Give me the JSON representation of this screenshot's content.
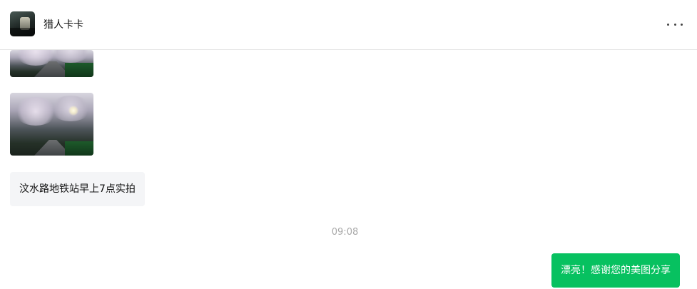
{
  "header": {
    "contact_name": "猎人卡卡",
    "avatar_icon": "avatar-image",
    "more_icon": "more-horizontal-icon"
  },
  "messages": {
    "photo_1": {
      "type": "image",
      "subject": "cherry blossom park path"
    },
    "photo_2": {
      "type": "image",
      "subject": "cherry blossom park path at dawn"
    },
    "incoming_text": "汶水路地铁站早上7点实拍",
    "timestamp": "09:08",
    "outgoing_text": "漂亮！感谢您的美图分享"
  },
  "colors": {
    "outgoing_bubble": "#07c160",
    "incoming_bubble": "#f4f5f7",
    "timestamp_text": "#a8a8a8",
    "header_divider": "#e6e6e6"
  }
}
